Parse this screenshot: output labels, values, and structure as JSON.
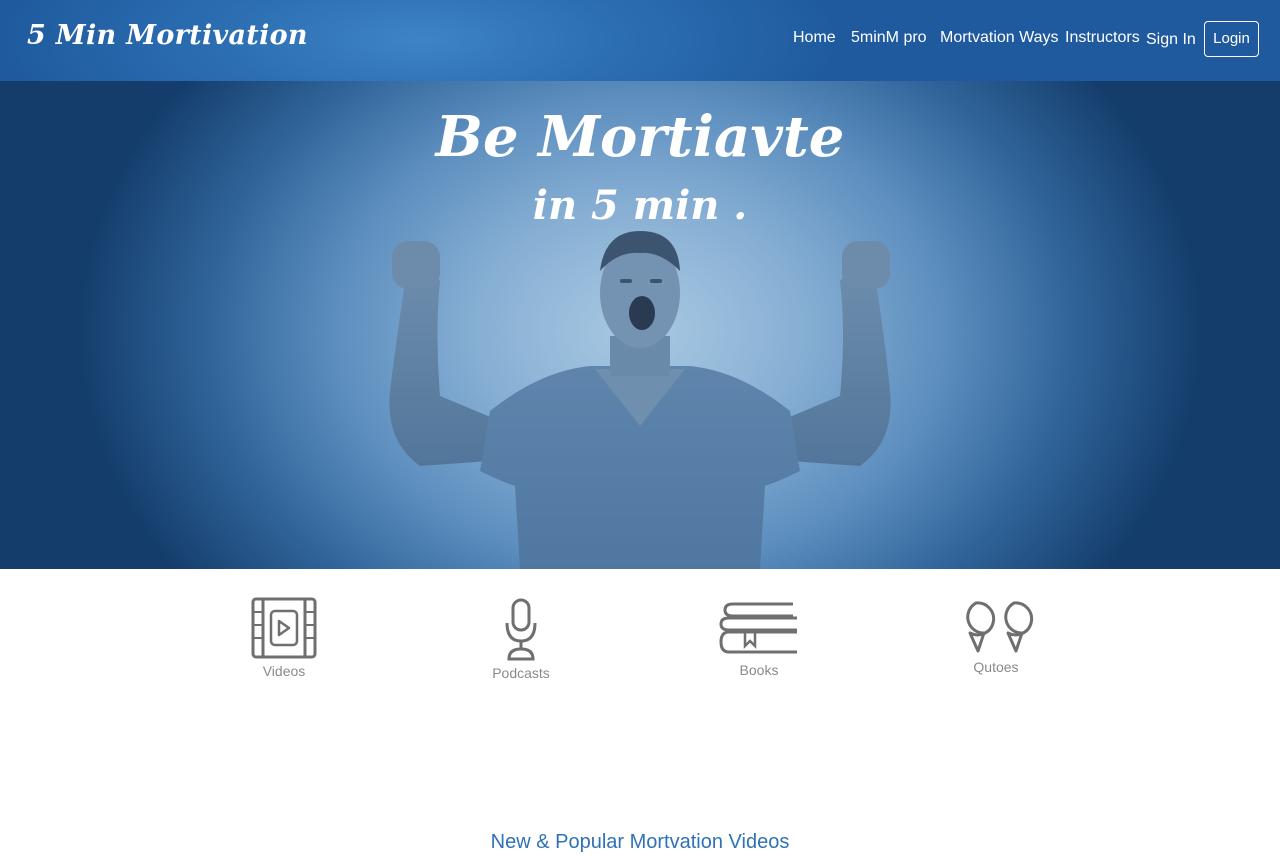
{
  "header": {
    "brand": "5 Min Mortivation",
    "nav": [
      "Home",
      "5minM pro",
      "Mortvation Ways",
      "Instructors",
      "Sign In"
    ],
    "login": "Login"
  },
  "hero": {
    "title": "Be Mortiavte",
    "subtitle": "in 5 min ."
  },
  "categories": [
    {
      "label": "Videos",
      "icon": "video-icon"
    },
    {
      "label": "Podcasts",
      "icon": "microphone-icon"
    },
    {
      "label": "Books",
      "icon": "books-icon"
    },
    {
      "label": "Qutoes",
      "icon": "quote-icon"
    }
  ],
  "section": {
    "title": "New & Popular Mortvation Videos"
  },
  "colors": {
    "header_blue": "#2d6fb3",
    "accent_blue": "#2f72b7",
    "icon_gray": "#6f6f6f"
  }
}
